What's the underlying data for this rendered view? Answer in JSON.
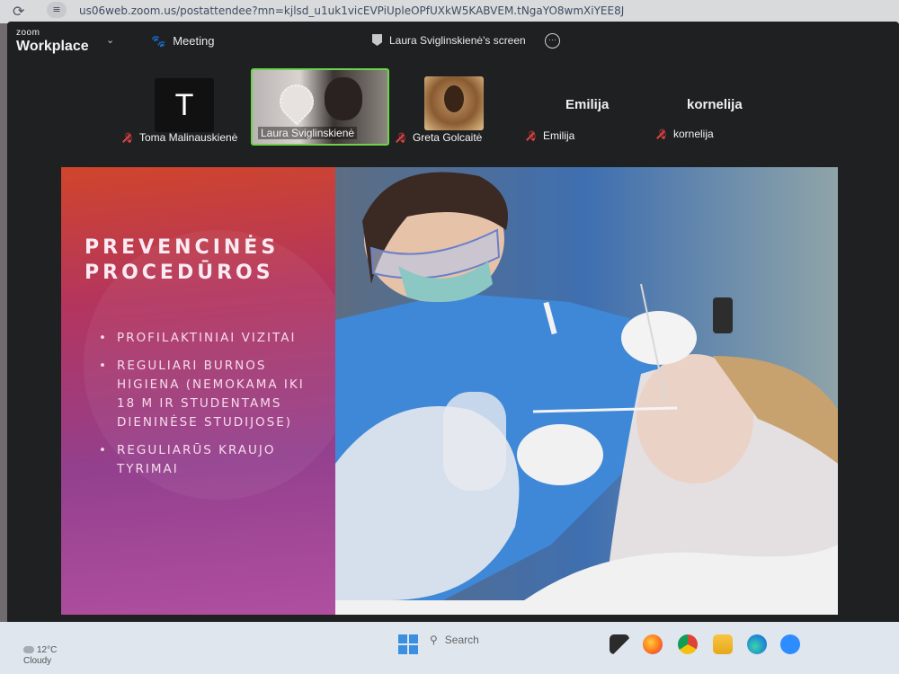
{
  "browser": {
    "url": "us06web.zoom.us/postattendee?mn=kjlsd_u1uk1vicEVPiUpleOPfUXkW5KABVEM.tNgaYO8wmXiYEE8J"
  },
  "app": {
    "brand_small": "zoom",
    "brand_big": "Workplace",
    "meeting_label": "Meeting",
    "screen_label": "Laura Sviglinskienė's screen",
    "more_label": "···"
  },
  "participants": [
    {
      "name": "Toma Malinauskienė",
      "avatar_letter": "T",
      "muted": true,
      "video": false
    },
    {
      "name": "Laura Sviglinskienė",
      "muted": false,
      "video": true,
      "active_speaker": true
    },
    {
      "name": "Greta Golcaitė",
      "muted": true,
      "video": false,
      "photo": true
    },
    {
      "name": "Emilija",
      "display_name": "Emilija",
      "muted": true,
      "video": false
    },
    {
      "name": "kornelija",
      "display_name": "kornelija",
      "muted": true,
      "video": false
    }
  ],
  "slide": {
    "title_line1": "PREVENCINĖS",
    "title_line2": "PROCEDŪROS",
    "bullets": [
      "PROFILAKTINIAI VIZITAI",
      "REGULIARI BURNOS HIGIENA (NEMOKAMA IKI 18 M IR STUDENTAMS DIENINĖSE STUDIJOSE)",
      "REGULIARŪS KRAUJO TYRIMAI"
    ]
  },
  "taskbar": {
    "weather_temp": "12°C",
    "weather_desc": "Cloudy",
    "search_placeholder": "Search"
  },
  "colors": {
    "active_speaker_border": "#6fd34a",
    "mic_muted": "#e04040",
    "windows_accent": "#3a8fe0"
  }
}
